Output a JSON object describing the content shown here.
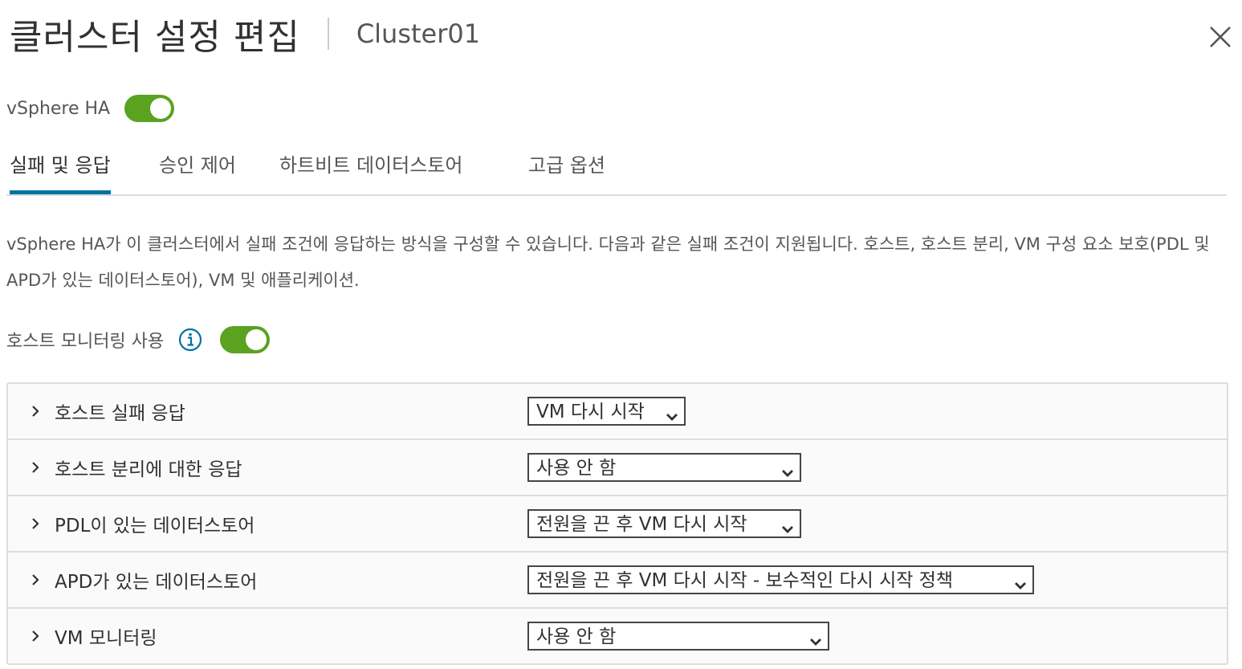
{
  "dialog": {
    "title": "클러스터 설정 편집",
    "subtitle": "Cluster01"
  },
  "ha": {
    "label": "vSphere HA",
    "enabled": true
  },
  "tabs": [
    {
      "label": "실패 및 응답",
      "active": true
    },
    {
      "label": "승인 제어",
      "active": false
    },
    {
      "label": "하트비트 데이터스토어",
      "active": false
    },
    {
      "label": "고급 옵션",
      "active": false
    }
  ],
  "description": "vSphere HA가 이 클러스터에서 실패 조건에 응답하는 방식을 구성할 수 있습니다. 다음과 같은 실패 조건이 지원됩니다. 호스트, 호스트 분리, VM 구성 요소 보호(PDL 및 APD가 있는 데이터스토어), VM 및 애플리케이션.",
  "host_monitoring": {
    "label": "호스트 모니터링 사용",
    "enabled": true
  },
  "failures": [
    {
      "label": "호스트 실패 응답",
      "value": "VM 다시 시작"
    },
    {
      "label": "호스트 분리에 대한 응답",
      "value": "사용 안 함"
    },
    {
      "label": "PDL이 있는 데이터스토어",
      "value": "전원을 끈 후 VM 다시 시작"
    },
    {
      "label": "APD가 있는 데이터스토어",
      "value": "전원을 끈 후 VM 다시 시작 - 보수적인 다시 시작 정책"
    },
    {
      "label": "VM 모니터링",
      "value": "사용 안 함"
    }
  ],
  "colors": {
    "toggle_on": "#5aa220",
    "tab_active": "#0072a3",
    "info": "#0072a3"
  },
  "icons": {
    "close": "close-icon",
    "info": "info-icon",
    "expand": "chevron-right-icon",
    "dropdown": "chevron-down-icon"
  }
}
